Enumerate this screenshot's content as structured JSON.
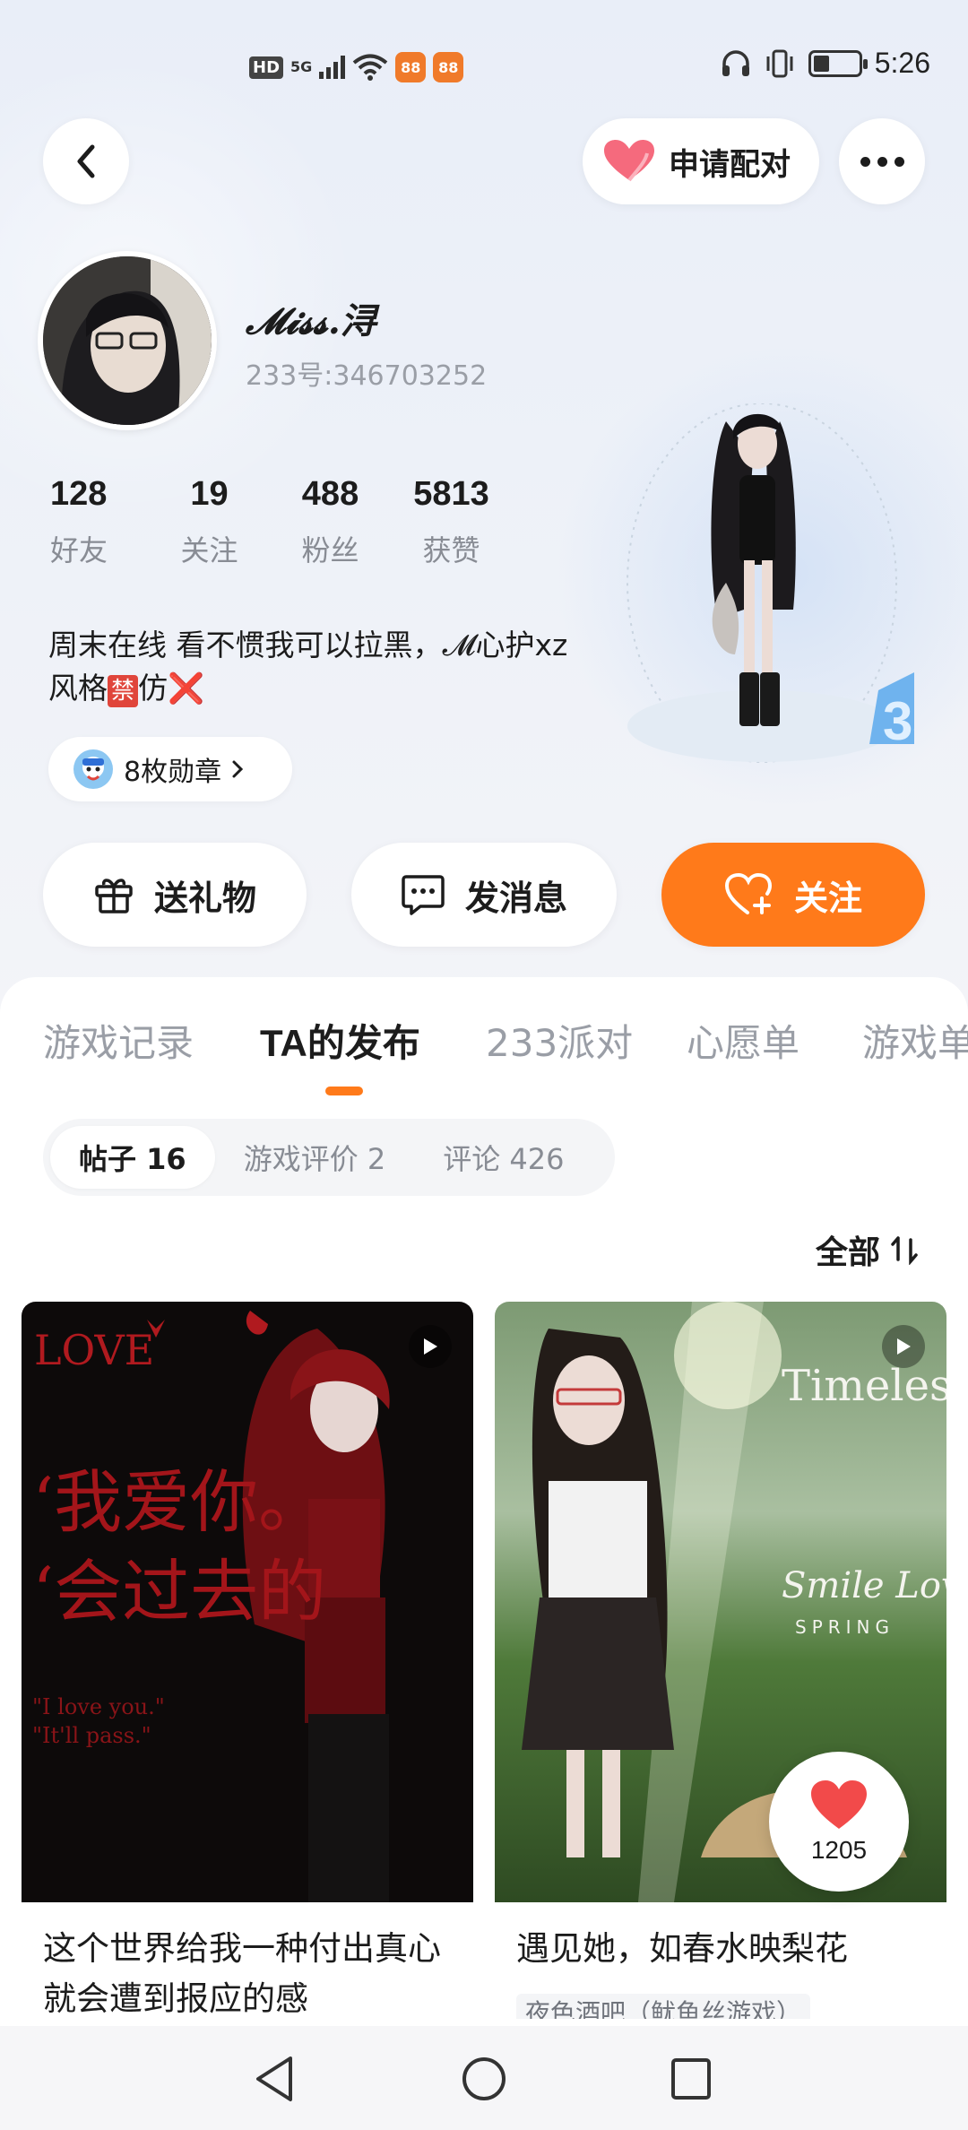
{
  "status_bar": {
    "hd": "HD",
    "network": "5G",
    "time": "5:26",
    "battery_level": 0.3
  },
  "header": {
    "pair_label": "申请配对"
  },
  "profile": {
    "username": "𝓜𝓲𝓼𝓼.浔",
    "user_id": "233号:346703252",
    "stats": [
      {
        "value": "128",
        "label": "好友"
      },
      {
        "value": "19",
        "label": "关注"
      },
      {
        "value": "488",
        "label": "粉丝"
      },
      {
        "value": "5813",
        "label": "获赞"
      }
    ],
    "bio_line1": "周末在线 看不惯我可以拉黑，𝓜心护xz",
    "bio_line2_prefix": "风格",
    "bio_ban_char": "禁",
    "bio_line2_suffix": "仿",
    "bio_x": "❌",
    "badges_label": "8枚勋章"
  },
  "actions": {
    "gift_label": "送礼物",
    "message_label": "发消息",
    "follow_label": "关注"
  },
  "tabs": [
    {
      "label": "游戏记录"
    },
    {
      "label": "TA的发布"
    },
    {
      "label": "233派对"
    },
    {
      "label": "心愿单"
    },
    {
      "label": "游戏单"
    }
  ],
  "subtabs": [
    {
      "label": "帖子 16"
    },
    {
      "label": "游戏评价 2"
    },
    {
      "label": "评论 426"
    }
  ],
  "sort_label": "全部",
  "posts": [
    {
      "title": "这个世界给我一种付出真心就会遭到报应的感",
      "image_text_love": "LOVE",
      "image_text_1": "‘我爱你。",
      "image_text_2": "‘会过去的",
      "image_text_3": "\"I love you.\"",
      "image_text_4": "\"It'll pass.\""
    },
    {
      "title": "遇见她，如春水映梨花",
      "tag": "夜色酒吧（鱿鱼丝游戏）",
      "image_text_1": "Timeless",
      "image_text_2": "Smile Love",
      "image_text_3": "SPRING",
      "likes": "1205"
    }
  ],
  "colors": {
    "accent": "#ff7a1a",
    "text": "#1c1c1c",
    "muted": "#9a9ea6"
  }
}
